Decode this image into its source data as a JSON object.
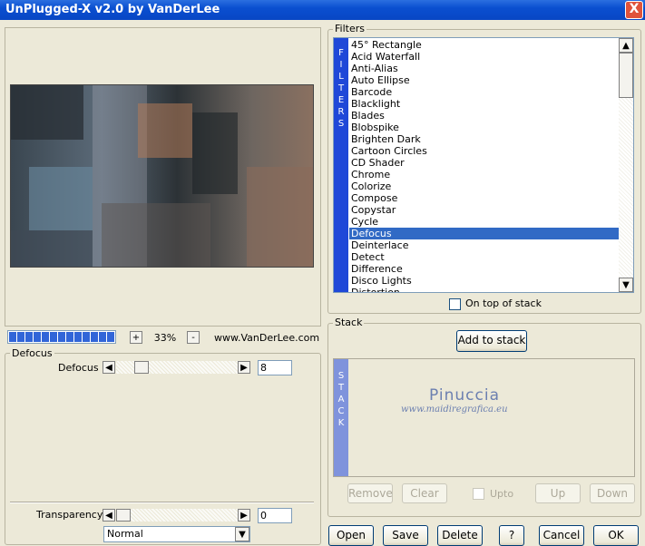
{
  "window": {
    "title": "UnPlugged-X v2.0 by VanDerLee",
    "close_symbol": "X"
  },
  "zoom": {
    "plus": "+",
    "value": "33%",
    "minus": "-",
    "website": "www.VanDerLee.com"
  },
  "filter_group": {
    "legend": "Defocus",
    "param_label": "Defocus",
    "param_value": "8",
    "transparency_label": "Transparency",
    "transparency_value": "0",
    "blend_mode": "Normal"
  },
  "filters": {
    "legend": "Filters",
    "side_label": [
      "F",
      "I",
      "L",
      "T",
      "E",
      "R",
      "S"
    ],
    "items": [
      "45° Rectangle",
      "Acid Waterfall",
      "Anti-Alias",
      "Auto Ellipse",
      "Barcode",
      "Blacklight",
      "Blades",
      "Blobspike",
      "Brighten Dark",
      "Cartoon Circles",
      "CD Shader",
      "Chrome",
      "Colorize",
      "Compose",
      "Copystar",
      "Cycle",
      "Defocus",
      "Deinterlace",
      "Detect",
      "Difference",
      "Disco Lights",
      "Distortion"
    ],
    "selected_index": 16,
    "on_top_label": "On top of stack"
  },
  "stack": {
    "legend": "Stack",
    "add_label": "Add to stack",
    "side_label": [
      "S",
      "T",
      "A",
      "C",
      "K"
    ],
    "watermark_title": "Pinuccia",
    "watermark_url": "www.maidiregrafica.eu",
    "remove_label": "Remove",
    "clear_label": "Clear",
    "upto_label": "Upto",
    "up_label": "Up",
    "down_label": "Down"
  },
  "footer": {
    "open": "Open",
    "save": "Save",
    "delete": "Delete",
    "help": "?",
    "cancel": "Cancel",
    "ok": "OK"
  },
  "colors": {
    "title_bar": "#0a4fd0",
    "selection": "#316ac5",
    "filters_side": "#1f48d8",
    "stack_side": "#7f93dc",
    "progress": "#3165d8"
  },
  "progress_segments": 13
}
